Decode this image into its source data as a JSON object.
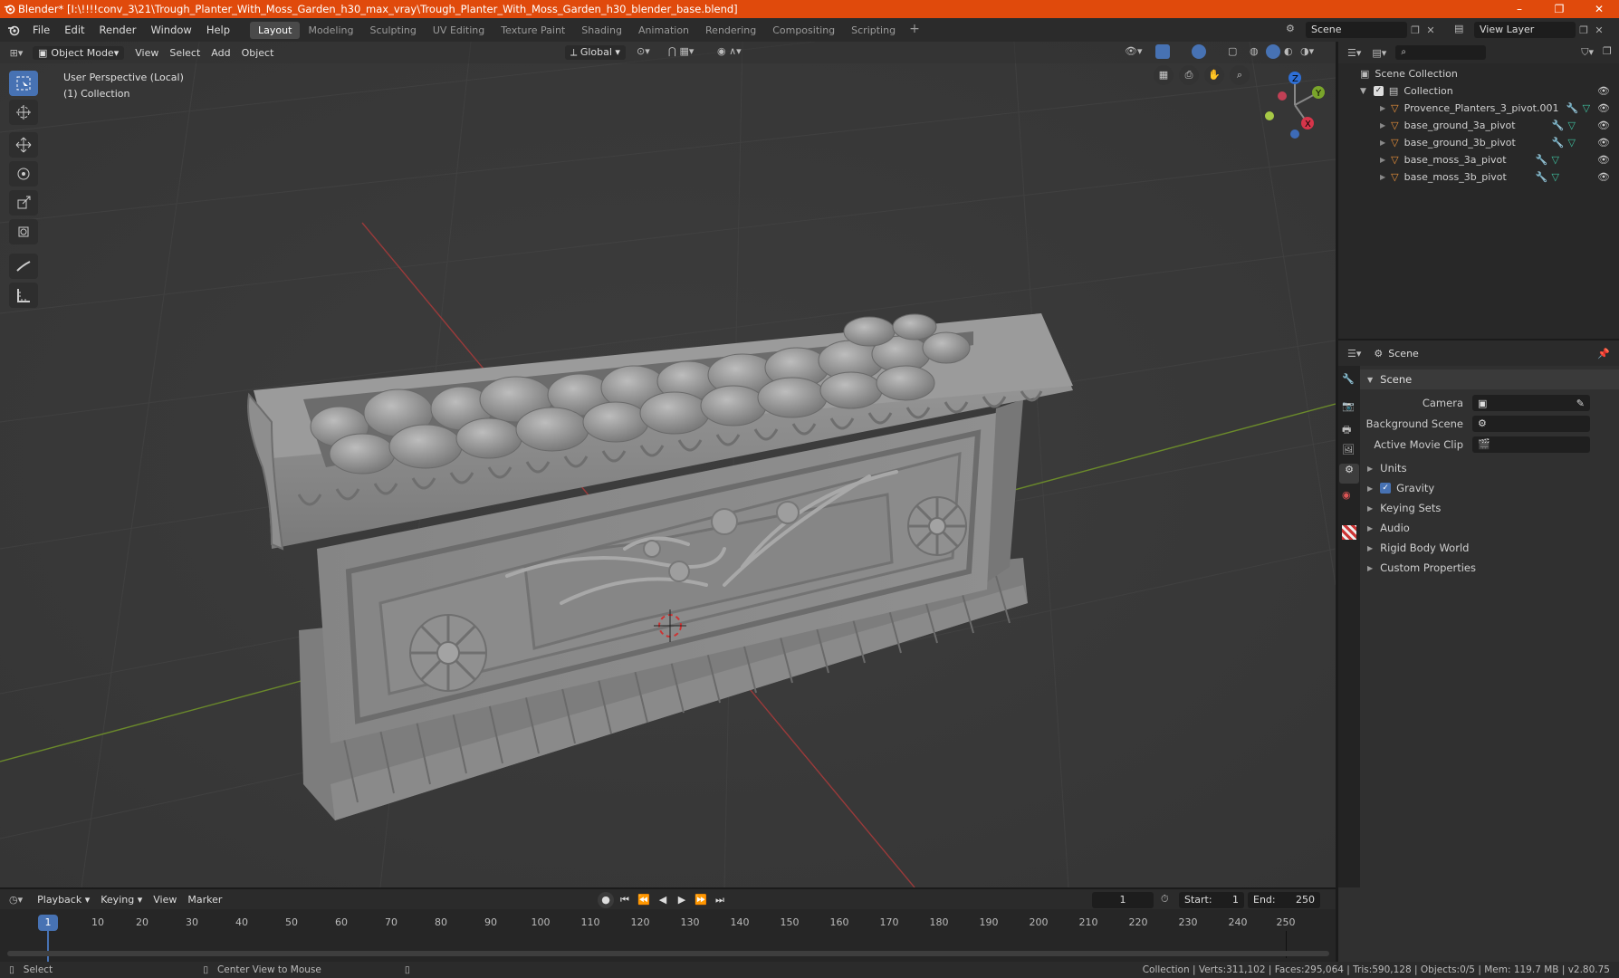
{
  "titlebar": {
    "title": "Blender* [I:\\!!!!conv_3\\21\\Trough_Planter_With_Moss_Garden_h30_max_vray\\Trough_Planter_With_Moss_Garden_h30_blender_base.blend]",
    "minimize": "–",
    "maximize": "❐",
    "close": "✕"
  },
  "menu": {
    "file": "File",
    "edit": "Edit",
    "render": "Render",
    "window": "Window",
    "help": "Help"
  },
  "workspaces": [
    "Layout",
    "Modeling",
    "Sculpting",
    "UV Editing",
    "Texture Paint",
    "Shading",
    "Animation",
    "Rendering",
    "Compositing",
    "Scripting"
  ],
  "scene_field": "Scene",
  "view_layer_field": "View Layer",
  "viewport_header": {
    "mode": "Object Mode",
    "view": "View",
    "select": "Select",
    "add": "Add",
    "object": "Object",
    "orientation": "Global"
  },
  "viewport_info": {
    "line1": "User Perspective (Local)",
    "line2": "(1) Collection"
  },
  "gizmo": {
    "x": "X",
    "y": "Y",
    "z": "Z"
  },
  "outliner": {
    "root": "Scene Collection",
    "collection": "Collection",
    "items": [
      "Provence_Planters_3_pivot.001",
      "base_ground_3a_pivot",
      "base_ground_3b_pivot",
      "base_moss_3a_pivot",
      "base_moss_3b_pivot"
    ]
  },
  "properties": {
    "header_scene": "Scene",
    "panel_title": "Scene",
    "camera_label": "Camera",
    "background_label": "Background Scene",
    "movie_clip_label": "Active Movie Clip",
    "sections": [
      "Units",
      "Gravity",
      "Keying Sets",
      "Audio",
      "Rigid Body World",
      "Custom Properties"
    ]
  },
  "timeline": {
    "playback": "Playback",
    "keying": "Keying",
    "view": "View",
    "marker": "Marker",
    "current_frame": "1",
    "start_label": "Start:",
    "start": "1",
    "end_label": "End:",
    "end": "250",
    "ticks": [
      "10",
      "20",
      "30",
      "40",
      "50",
      "60",
      "70",
      "80",
      "90",
      "100",
      "110",
      "120",
      "130",
      "140",
      "150",
      "160",
      "170",
      "180",
      "190",
      "200",
      "210",
      "220",
      "230",
      "240",
      "250"
    ]
  },
  "status": {
    "select": "Select",
    "center_view": "Center View to Mouse",
    "stats": "Collection | Verts:311,102 | Faces:295,064 | Tris:590,128 | Objects:0/5 | Mem: 119.7 MB | v2.80.75"
  }
}
